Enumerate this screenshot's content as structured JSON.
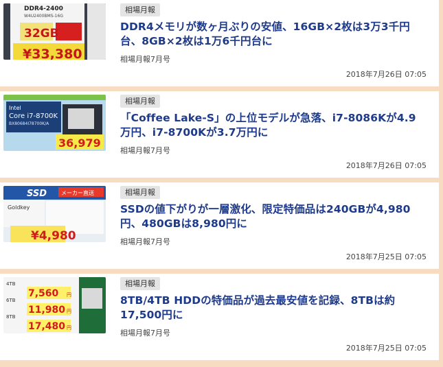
{
  "articles": [
    {
      "badge": "相場月報",
      "title": "DDR4メモリが数ヶ月ぶりの安値、16GB×2枚は3万3千円台、8GB×2枚は1万6千円台に",
      "subtitle": "相場月報7月号",
      "date": "2018年7月26日 07:05",
      "thumb": {
        "label1": "DDR4-2400",
        "label2": "W4U2400BMS-16G",
        "size": "32GB",
        "price": "¥33,380"
      }
    },
    {
      "badge": "相場月報",
      "title": "「Coffee Lake-S」の上位モデルが急落、i7-8086Kが4.9万円、i7-8700Kが3.7万円に",
      "subtitle": "相場月報7月号",
      "date": "2018年7月26日 07:05",
      "thumb": {
        "brand": "Intel",
        "model": "Core i7-8700K",
        "part": "BX80684I78700K/A",
        "price": "36,979"
      }
    },
    {
      "badge": "相場月報",
      "title": "SSDの値下がりが一層激化、限定特価品は240GBが4,980円、480GBは8,980円に",
      "subtitle": "相場月報7月号",
      "date": "2018年7月25日 07:05",
      "thumb": {
        "head": "SSD",
        "tag": "メーカー直送",
        "brand": "Goldkey",
        "price": "¥4,980"
      }
    },
    {
      "badge": "相場月報",
      "title": "8TB/4TB HDDの特価品が過去最安値を記録、8TBは約17,500円に",
      "subtitle": "相場月報7月号",
      "date": "2018年7月25日 07:05",
      "thumb": {
        "l1": "4TB",
        "p1": "7,560",
        "l2": "6TB",
        "p2": "11,980",
        "l3": "8TB",
        "p3": "17,480",
        "yen": "円"
      }
    }
  ]
}
